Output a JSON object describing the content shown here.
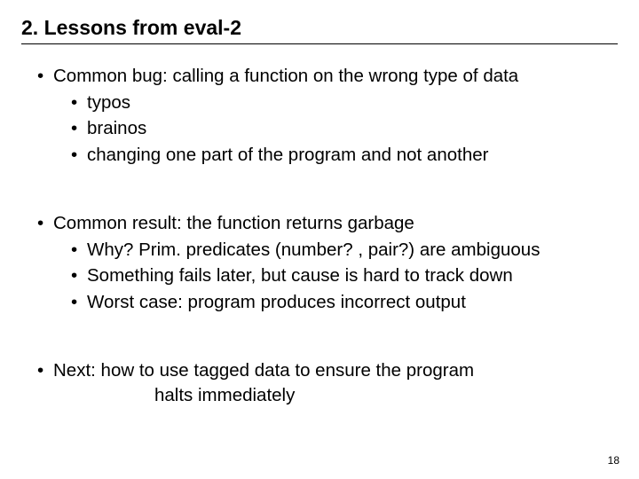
{
  "title": "2. Lessons from eval-2",
  "section1": {
    "lead": "Common bug: calling a function on the wrong type of data",
    "sub1": "typos",
    "sub2": "brainos",
    "sub3": "changing one part of the program and not another"
  },
  "section2": {
    "lead": "Common result: the function returns garbage",
    "sub1": "Why? Prim. predicates (number? , pair?) are ambiguous",
    "sub2": "Something fails later, but cause is hard to track down",
    "sub3": "Worst case: program produces incorrect output"
  },
  "section3": {
    "lead": "Next: how to use tagged data to ensure the program",
    "cont": "halts immediately"
  },
  "pagenum": "18"
}
